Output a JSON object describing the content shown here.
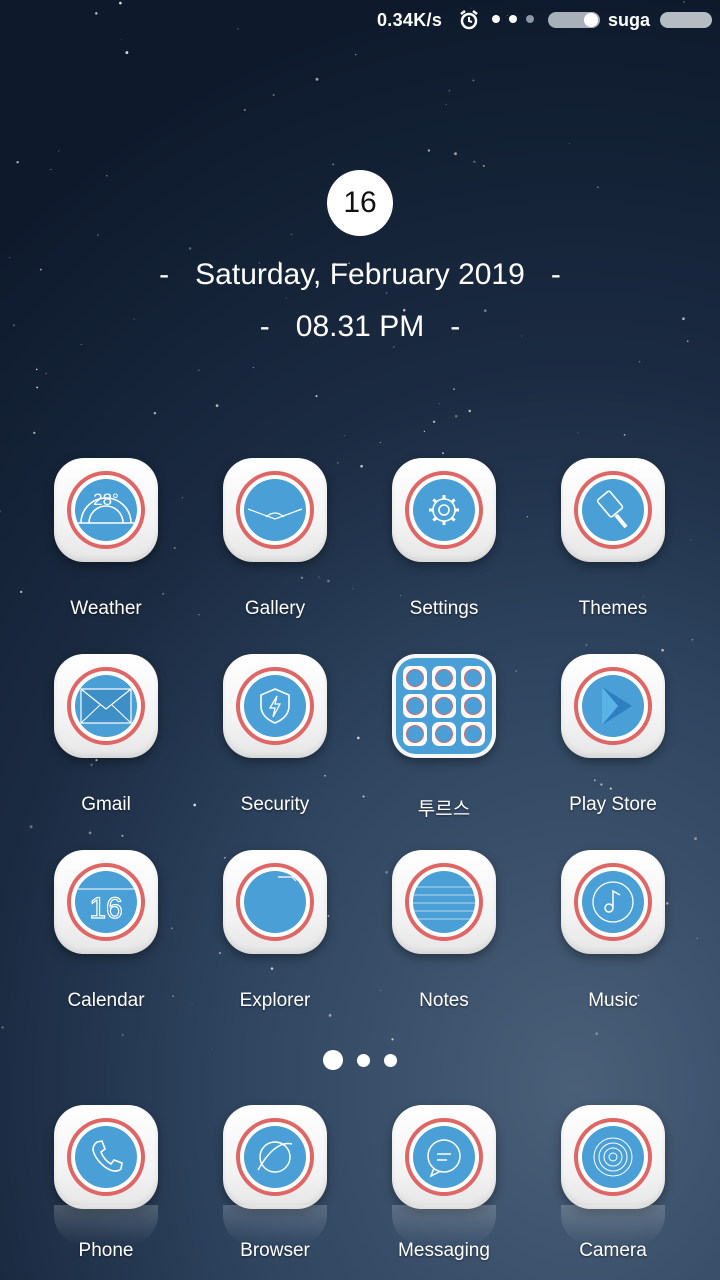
{
  "status_bar": {
    "net_speed": "0.34K/s",
    "carrier": "suga",
    "alarm_icon": "alarm-clock-icon",
    "signal_dots": 3
  },
  "clock": {
    "day": "16",
    "date": "Saturday, February 2019",
    "time": "08.31 PM",
    "dash": "-"
  },
  "apps": {
    "weather": "Weather",
    "gallery": "Gallery",
    "settings": "Settings",
    "themes": "Themes",
    "gmail": "Gmail",
    "security": "Security",
    "folder": "투르스",
    "play_store": "Play Store",
    "calendar": "Calendar",
    "explorer": "Explorer",
    "notes": "Notes",
    "music": "Music"
  },
  "weather_temp": "28°",
  "calendar_day": "16",
  "dock": {
    "phone": "Phone",
    "browser": "Browser",
    "messaging": "Messaging",
    "camera": "Camera"
  },
  "pager": {
    "pages": 3,
    "current": 1
  },
  "colors": {
    "icon_blue": "#4a9fd6",
    "icon_ring": "#e06666",
    "tile": "#f4f4f4",
    "wallpaper_top": "#0e1a2c",
    "wallpaper_bottom": "#4a5f78"
  }
}
